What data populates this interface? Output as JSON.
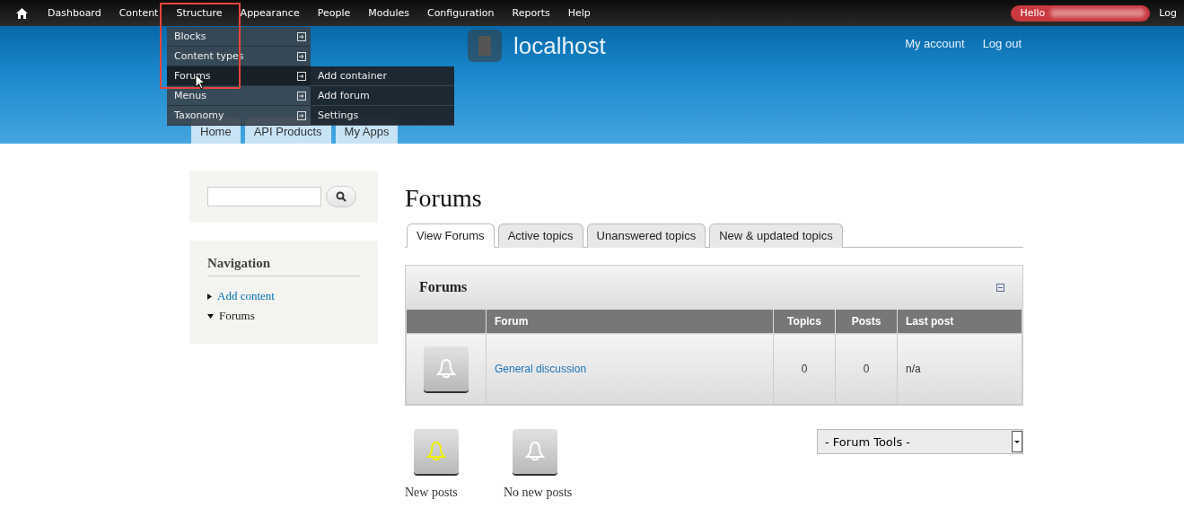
{
  "toolbar": {
    "items": [
      {
        "label": "Dashboard"
      },
      {
        "label": "Content"
      },
      {
        "label": "Structure"
      },
      {
        "label": "Appearance"
      },
      {
        "label": "People"
      },
      {
        "label": "Modules"
      },
      {
        "label": "Configuration"
      },
      {
        "label": "Reports"
      },
      {
        "label": "Help"
      }
    ],
    "greeting": "Hello",
    "logout": "Log"
  },
  "dropdown": {
    "items": [
      {
        "label": "Blocks",
        "selected": false
      },
      {
        "label": "Content types",
        "selected": false
      },
      {
        "label": "Forums",
        "selected": true
      },
      {
        "label": "Menus",
        "selected": false
      },
      {
        "label": "Taxonomy",
        "selected": false
      }
    ],
    "submenu": [
      "Add container",
      "Add forum",
      "Settings"
    ]
  },
  "header": {
    "site_name": "localhost",
    "links": [
      "My account",
      "Log out"
    ],
    "tabs": [
      "Home",
      "API Products",
      "My Apps"
    ]
  },
  "sidebar": {
    "navigation": {
      "title": "Navigation",
      "items": [
        {
          "label": "Add content",
          "expanded": false,
          "selected": false
        },
        {
          "label": "Forums",
          "expanded": true,
          "selected": true
        }
      ]
    }
  },
  "content": {
    "title": "Forums",
    "tabs": [
      {
        "label": "View Forums",
        "selected": true
      },
      {
        "label": "Active topics",
        "selected": false
      },
      {
        "label": "Unanswered topics",
        "selected": false
      },
      {
        "label": "New & updated topics",
        "selected": false
      }
    ],
    "block_title": "Forums",
    "table": {
      "columns": [
        "Forum",
        "Topics",
        "Posts",
        "Last post"
      ],
      "rows": [
        {
          "new_posts": false,
          "forum": "General discussion",
          "topics": "0",
          "posts": "0",
          "last_post": "n/a"
        }
      ]
    },
    "legend": [
      {
        "new_posts": true,
        "label": "New posts"
      },
      {
        "new_posts": false,
        "label": "No new posts"
      }
    ],
    "forum_tools": "- Forum Tools -"
  }
}
